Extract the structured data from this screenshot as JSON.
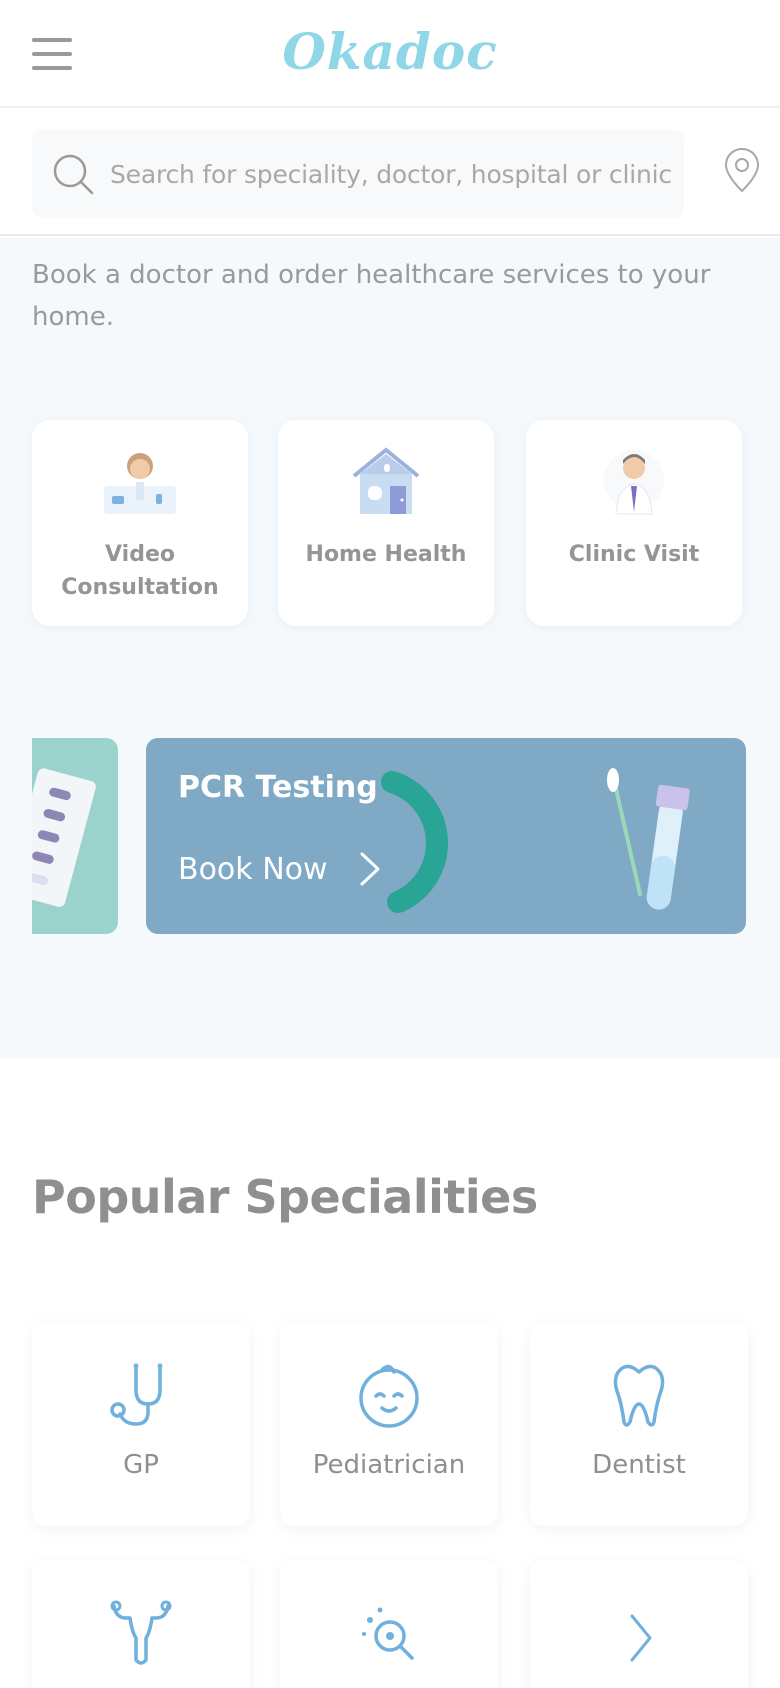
{
  "header": {
    "menu_icon": "hamburger-menu-icon",
    "logo_text": "Okadoc"
  },
  "search": {
    "placeholder": "Search for speciality, doctor, hospital or clinic",
    "icon": "search-icon",
    "location_icon": "location-pin-icon"
  },
  "hero": {
    "tagline": "Book a doctor and order healthcare services to your home.",
    "services": [
      {
        "label": "Video Consultation",
        "icon": "video-consultation-doctor-icon"
      },
      {
        "label": "Home Health",
        "icon": "house-icon"
      },
      {
        "label": "Clinic Visit",
        "icon": "clinic-doctor-icon"
      }
    ],
    "banner": {
      "title": "PCR Testing",
      "cta": "Book Now",
      "color": "#7fa9c5",
      "side_banner_color": "#9bd3cc"
    }
  },
  "specialities": {
    "title": "Popular Specialities",
    "items": [
      {
        "label": "GP",
        "icon": "stethoscope-icon"
      },
      {
        "label": "Pediatrician",
        "icon": "baby-face-icon"
      },
      {
        "label": "Dentist",
        "icon": "tooth-icon"
      },
      {
        "label": "",
        "icon": "uterus-icon"
      },
      {
        "label": "",
        "icon": "dermatology-magnifier-icon"
      },
      {
        "label": "",
        "icon": "chevron-right-icon"
      }
    ]
  },
  "colors": {
    "brand": "#8fd6e6",
    "icon_blue": "#6fb0dc",
    "text": "#8f8f8f",
    "hero_bg": "#f5f9fc"
  }
}
